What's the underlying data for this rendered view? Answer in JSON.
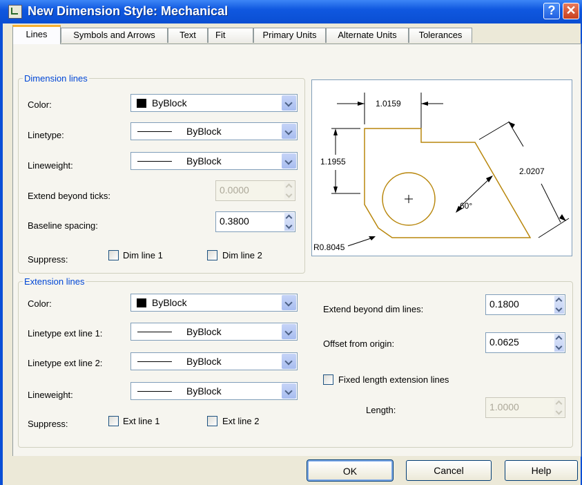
{
  "window": {
    "title": "New Dimension Style: Mechanical",
    "help_glyph": "?",
    "close_glyph": "✕"
  },
  "tabs": [
    {
      "label": "Lines",
      "active": true
    },
    {
      "label": "Symbols and Arrows"
    },
    {
      "label": "Text"
    },
    {
      "label": "Fit"
    },
    {
      "label": "Primary Units"
    },
    {
      "label": "Alternate Units"
    },
    {
      "label": "Tolerances"
    }
  ],
  "dimension_lines": {
    "legend": "Dimension lines",
    "color_label": "Color:",
    "color_value": "ByBlock",
    "linetype_label": "Linetype:",
    "linetype_value": "ByBlock",
    "lineweight_label": "Lineweight:",
    "lineweight_value": "ByBlock",
    "extend_label": "Extend beyond ticks:",
    "extend_value": "0.0000",
    "baseline_label": "Baseline spacing:",
    "baseline_value": "0.3800",
    "suppress_label": "Suppress:",
    "dim_line_1": "Dim line 1",
    "dim_line_2": "Dim line 2"
  },
  "extension_lines": {
    "legend": "Extension lines",
    "color_label": "Color:",
    "color_value": "ByBlock",
    "linetype1_label": "Linetype ext line 1:",
    "linetype1_value": "ByBlock",
    "linetype2_label": "Linetype ext line 2:",
    "linetype2_value": "ByBlock",
    "lineweight_label": "Lineweight:",
    "lineweight_value": "ByBlock",
    "suppress_label": "Suppress:",
    "ext_line_1": "Ext line 1",
    "ext_line_2": "Ext line 2",
    "extend_dim_label": "Extend beyond dim lines:",
    "extend_dim_value": "0.1800",
    "offset_label": "Offset from origin:",
    "offset_value": "0.0625",
    "fixed_length_label": "Fixed length extension lines",
    "length_label": "Length:",
    "length_value": "1.0000"
  },
  "preview": {
    "dim_top": "1.0159",
    "dim_left": "1.1955",
    "dim_right": "2.0207",
    "angle": "60°",
    "radius": "R0.8045"
  },
  "buttons": {
    "ok": "OK",
    "cancel": "Cancel",
    "help": "Help"
  },
  "colors": {
    "title_bar": "#0a4fd6",
    "legend": "#0046d5",
    "preview_shape": "#b8860b"
  }
}
